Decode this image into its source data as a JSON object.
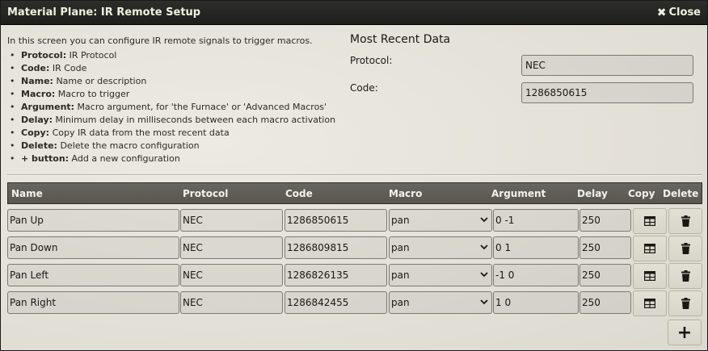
{
  "window": {
    "title": "Material Plane: IR Remote Setup",
    "close_label": "Close"
  },
  "intro": {
    "text": "In this screen you can configure IR remote signals to trigger macros.",
    "items": [
      {
        "term": "Protocol:",
        "desc": " IR Protocol"
      },
      {
        "term": "Code:",
        "desc": " IR Code"
      },
      {
        "term": "Name:",
        "desc": " Name or description"
      },
      {
        "term": "Macro:",
        "desc": " Macro to trigger"
      },
      {
        "term": "Argument:",
        "desc": " Macro argument, for 'the Furnace' or 'Advanced Macros'"
      },
      {
        "term": "Delay:",
        "desc": " Minimum delay in milliseconds between each macro activation"
      },
      {
        "term": "Copy:",
        "desc": " Copy IR data from the most recent data"
      },
      {
        "term": "Delete:",
        "desc": " Delete the macro configuration"
      },
      {
        "term": "+ button:",
        "desc": " Add a new configuration"
      }
    ]
  },
  "recent": {
    "title": "Most Recent Data",
    "protocol_label": "Protocol:",
    "protocol_value": "NEC",
    "code_label": "Code:",
    "code_value": "1286850615"
  },
  "table": {
    "headers": {
      "name": "Name",
      "protocol": "Protocol",
      "code": "Code",
      "macro": "Macro",
      "argument": "Argument",
      "delay": "Delay",
      "copy": "Copy",
      "delete": "Delete"
    },
    "rows": [
      {
        "name": "Pan Up",
        "protocol": "NEC",
        "code": "1286850615",
        "macro": "pan",
        "argument": "0 -1",
        "delay": "250"
      },
      {
        "name": "Pan Down",
        "protocol": "NEC",
        "code": "1286809815",
        "macro": "pan",
        "argument": "0 1",
        "delay": "250"
      },
      {
        "name": "Pan Left",
        "protocol": "NEC",
        "code": "1286826135",
        "macro": "pan",
        "argument": "-1 0",
        "delay": "250"
      },
      {
        "name": "Pan Right",
        "protocol": "NEC",
        "code": "1286842455",
        "macro": "pan",
        "argument": "1 0",
        "delay": "250"
      }
    ]
  },
  "add_button_label": "+",
  "icons": {
    "close": "close-icon",
    "copy": "table-icon",
    "delete": "trash-icon",
    "select": "chevron-down-icon"
  }
}
